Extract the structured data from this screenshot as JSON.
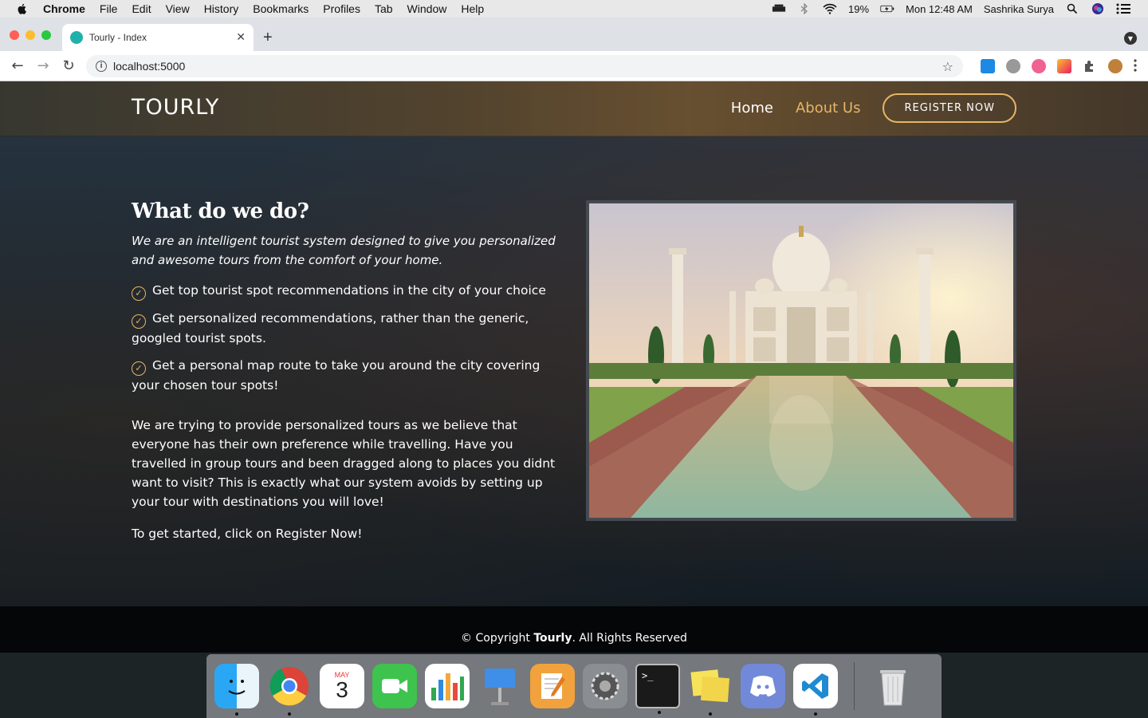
{
  "menubar": {
    "app": "Chrome",
    "items": [
      "File",
      "Edit",
      "View",
      "History",
      "Bookmarks",
      "Profiles",
      "Tab",
      "Window",
      "Help"
    ],
    "battery": "19%",
    "clock": "Mon 12:48 AM",
    "user": "Sashrika Surya"
  },
  "browser": {
    "tab_title": "Tourly - Index",
    "url": "localhost:5000"
  },
  "site": {
    "logo": "TOURLY",
    "nav": {
      "home": "Home",
      "about": "About Us",
      "register": "REGISTER NOW"
    },
    "heading": "What do we do?",
    "lead": "We are an intelligent tourist system designed to give you personalized and awesome tours from the comfort of your home.",
    "features": [
      "Get top tourist spot recommendations in the city of your choice",
      "Get personalized recommendations, rather than the generic, googled tourist spots.",
      "Get a personal map route to take you around the city covering your chosen tour spots!"
    ],
    "body": "We are trying to provide personalized tours as we believe that everyone has their own preference while travelling. Have you travelled in group tours and been dragged along to places you didnt want to visit? This is exactly what our system avoids by setting up your tour with destinations you will love!",
    "cta": "To get started, click on Register Now!",
    "footer": {
      "prefix": "© Copyright ",
      "brand": "Tourly",
      "suffix": ". All Rights Reserved"
    }
  },
  "dock": {
    "calendar_month": "MAY",
    "calendar_day": "3"
  },
  "colors": {
    "accent": "#e6b566",
    "footer_bg": "#050607"
  }
}
